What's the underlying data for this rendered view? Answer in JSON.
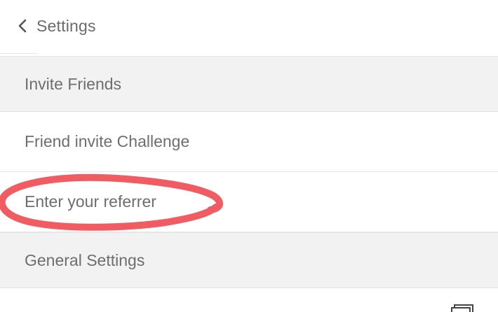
{
  "header": {
    "back_label": "Settings",
    "back_icon": "chevron-left-icon"
  },
  "rows": [
    {
      "label": "Invite Friends",
      "kind": "section-header"
    },
    {
      "label": "Friend invite Challenge",
      "kind": "menu-item"
    },
    {
      "label": "Enter your referrer",
      "kind": "menu-item",
      "highlighted": true
    },
    {
      "label": "General Settings",
      "kind": "section-header"
    }
  ],
  "annotation": {
    "shape": "hand-drawn-ellipse",
    "color": "#f0525a",
    "target": "Enter your referrer"
  },
  "bottom_icon": "copy-icon",
  "colors": {
    "section_bg": "#f2f2f2",
    "text": "#6e6e6e",
    "divider": "#e6e6e6",
    "annotation": "#f0525a"
  }
}
